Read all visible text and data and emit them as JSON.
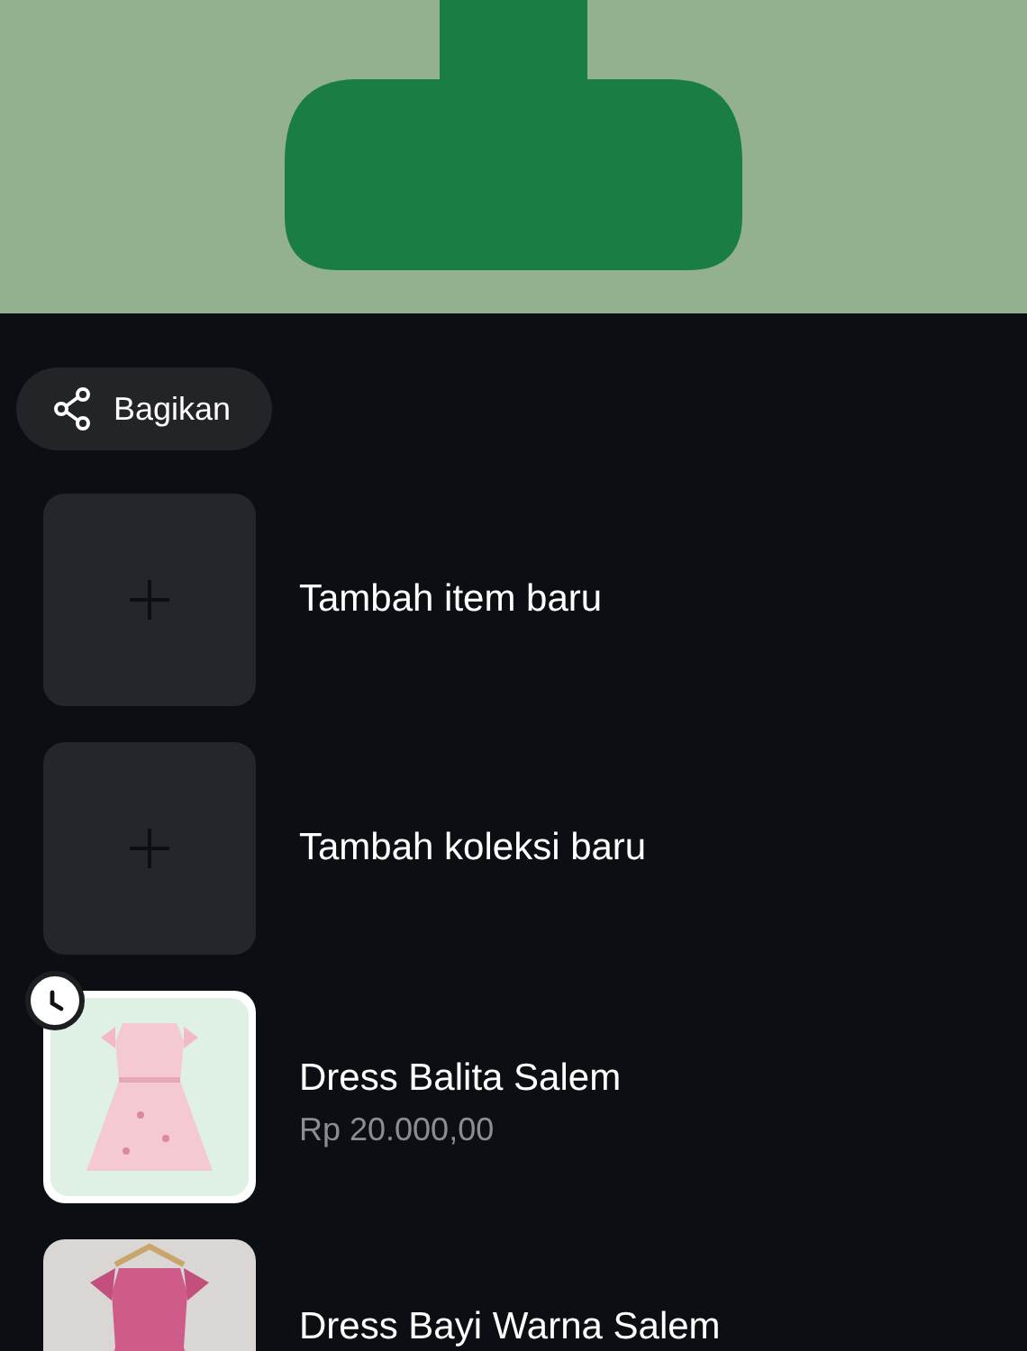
{
  "share_button": {
    "label": "Bagikan"
  },
  "items": [
    {
      "kind": "add",
      "title": "Tambah item baru"
    },
    {
      "kind": "add",
      "title": "Tambah koleksi baru"
    },
    {
      "kind": "product",
      "title": "Dress Balita Salem",
      "price": "Rp 20.000,00",
      "pending": true
    },
    {
      "kind": "product",
      "title": "Dress Bayi Warna Salem",
      "pending": false
    }
  ]
}
